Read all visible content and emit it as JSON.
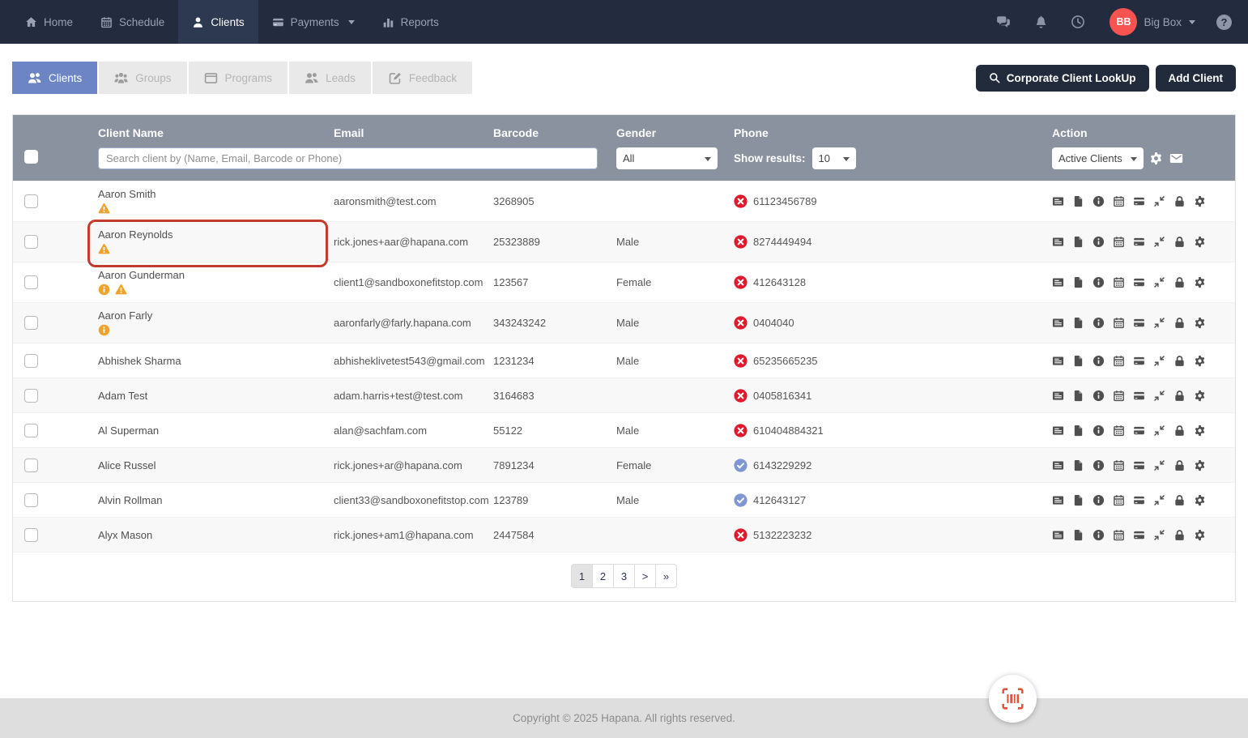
{
  "navbar": {
    "items": [
      {
        "label": "Home",
        "icon": "home-icon"
      },
      {
        "label": "Schedule",
        "icon": "calendar-icon"
      },
      {
        "label": "Clients",
        "icon": "user-icon",
        "active": true
      },
      {
        "label": "Payments",
        "icon": "credit-card-icon",
        "caret": true
      },
      {
        "label": "Reports",
        "icon": "bar-chart-icon"
      }
    ],
    "right": {
      "avatar_initials": "BB",
      "account_name": "Big Box",
      "help_glyph": "?"
    }
  },
  "tabs": [
    {
      "label": "Clients",
      "icon": "users-icon",
      "active": true
    },
    {
      "label": "Groups",
      "icon": "groups-icon"
    },
    {
      "label": "Programs",
      "icon": "programs-icon"
    },
    {
      "label": "Leads",
      "icon": "leads-icon"
    },
    {
      "label": "Feedback",
      "icon": "feedback-icon"
    }
  ],
  "toolbar": {
    "corporate_lookup_label": "Corporate Client LookUp",
    "add_client_label": "Add Client"
  },
  "table": {
    "columns": [
      "Client Name",
      "Email",
      "Barcode",
      "Gender",
      "Phone",
      "Action"
    ],
    "filters": {
      "search_placeholder": "Search client by (Name, Email, Barcode or Phone)",
      "gender_value": "All",
      "show_results_label": "Show results:",
      "show_results_value": "10",
      "status_value": "Active Clients"
    },
    "action_icons": [
      "membership-icon",
      "file-icon",
      "info-action-icon",
      "calendar-icon",
      "credit-card-icon",
      "compress-icon",
      "lock-icon",
      "gear-icon"
    ],
    "rows": [
      {
        "name": "Aaron Smith",
        "email": "aaronsmith@test.com",
        "barcode": "3268905",
        "gender": "",
        "phone": "61123456789",
        "phone_status": "invalid",
        "badges": [
          "warning"
        ],
        "highlighted": false
      },
      {
        "name": "Aaron Reynolds",
        "email": "rick.jones+aar@hapana.com",
        "barcode": "25323889",
        "gender": "Male",
        "phone": "8274449494",
        "phone_status": "invalid",
        "badges": [
          "warning"
        ],
        "highlighted": true
      },
      {
        "name": "Aaron Gunderman",
        "email": "client1@sandboxonefitstop.com",
        "barcode": "123567",
        "gender": "Female",
        "phone": "412643128",
        "phone_status": "invalid",
        "badges": [
          "info",
          "warning"
        ],
        "highlighted": false
      },
      {
        "name": "Aaron Farly",
        "email": "aaronfarly@farly.hapana.com",
        "barcode": "343243242",
        "gender": "Male",
        "phone": "0404040",
        "phone_status": "invalid",
        "badges": [
          "info"
        ],
        "highlighted": false
      },
      {
        "name": "Abhishek Sharma",
        "email": "abhisheklivetest543@gmail.com",
        "barcode": "1231234",
        "gender": "Male",
        "phone": "65235665235",
        "phone_status": "invalid",
        "badges": [],
        "highlighted": false
      },
      {
        "name": "Adam Test",
        "email": "adam.harris+test@test.com",
        "barcode": "3164683",
        "gender": "",
        "phone": "0405816341",
        "phone_status": "invalid",
        "badges": [],
        "highlighted": false
      },
      {
        "name": "Al Superman",
        "email": "alan@sachfam.com",
        "barcode": "55122",
        "gender": "Male",
        "phone": "610404884321",
        "phone_status": "invalid",
        "badges": [],
        "highlighted": false
      },
      {
        "name": "Alice Russel",
        "email": "rick.jones+ar@hapana.com",
        "barcode": "7891234",
        "gender": "Female",
        "phone": "6143229292",
        "phone_status": "verified",
        "badges": [],
        "highlighted": false
      },
      {
        "name": "Alvin Rollman",
        "email": "client33@sandboxonefitstop.com",
        "barcode": "123789",
        "gender": "Male",
        "phone": "412643127",
        "phone_status": "verified",
        "badges": [],
        "highlighted": false
      },
      {
        "name": "Alyx Mason",
        "email": "rick.jones+am1@hapana.com",
        "barcode": "2447584",
        "gender": "",
        "phone": "5132223232",
        "phone_status": "invalid",
        "badges": [],
        "highlighted": false
      }
    ]
  },
  "pagination": {
    "pages": [
      "1",
      "2",
      "3",
      ">",
      "»"
    ],
    "active_index": 0
  },
  "footer": {
    "copyright": "Copyright © 2025 Hapana. All rights reserved."
  },
  "colors": {
    "navbar_bg": "#232c3f",
    "navbar_active_bg": "#2d3950",
    "table_header_bg": "#8b929f",
    "active_tab": "#6d85c5",
    "warning_orange": "#f0a32c",
    "phone_invalid_red": "#e01a2c",
    "phone_verified_blue": "#7e97d3",
    "highlight_red": "#c23b2e",
    "avatar_red": "#f75350",
    "fab_icon_orange": "#e8503a",
    "dark_button": "#222b3c",
    "footer_bg": "#dedede"
  }
}
